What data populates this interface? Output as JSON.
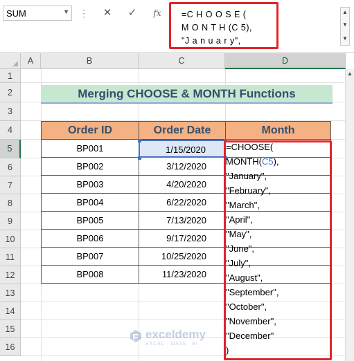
{
  "formula_bar": {
    "name_box": "SUM",
    "name_box_dropdown_icon": "chevron-down-icon",
    "cancel_icon": "✕",
    "enter_icon": "✓",
    "fx_label": "fx",
    "formula_lines": [
      "=C H O O S E (",
      "M O N T H (C 5),",
      "\"J a n u a r y\","
    ]
  },
  "columns": [
    "A",
    "B",
    "C",
    "D"
  ],
  "selected_column": "D",
  "rows": [
    "1",
    "2",
    "3",
    "4",
    "5",
    "6",
    "7",
    "8",
    "9",
    "10",
    "11",
    "12",
    "13",
    "14",
    "15",
    "16"
  ],
  "selected_row": "5",
  "title": "Merging CHOOSE & MONTH Functions",
  "table": {
    "headers": [
      "Order ID",
      "Order Date",
      "Month"
    ],
    "rows": [
      [
        "BP001",
        "1/15/2020"
      ],
      [
        "BP002",
        "3/12/2020"
      ],
      [
        "BP003",
        "4/20/2020"
      ],
      [
        "BP004",
        "6/22/2020"
      ],
      [
        "BP005",
        "7/13/2020"
      ],
      [
        "BP006",
        "9/17/2020"
      ],
      [
        "BP007",
        "10/25/2020"
      ],
      [
        "BP008",
        "11/23/2020"
      ]
    ]
  },
  "cell_formula": {
    "line1": "=CHOOSE(",
    "line2_prefix": "MONTH(",
    "line2_ref": "C5",
    "line2_suffix": "),",
    "months": [
      "\"January\",",
      "\"February\",",
      "\"March\",",
      "\"April\",",
      "\"May\",",
      "\"June\",",
      "\"July\",",
      "\"August\",",
      "\"September\",",
      "\"October\",",
      "\"November\",",
      "\"December\""
    ],
    "close": ")"
  },
  "watermark": {
    "name": "exceldemy",
    "tagline": "EXCEL · DATA · BI"
  },
  "colors": {
    "highlight_border": "#e0242a",
    "header_fill": "#f4b183",
    "title_fill": "#c6e8d0",
    "active_cell_border": "#4472c4"
  }
}
